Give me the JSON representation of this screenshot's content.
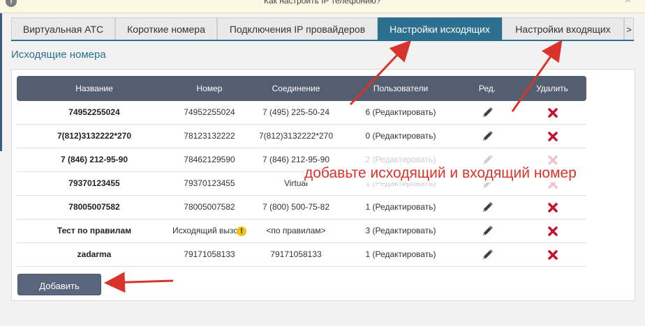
{
  "topbar": {
    "help_link": "Как настроить IP телефонию?",
    "close": "×",
    "info": "!"
  },
  "tabs": [
    {
      "label": "Виртуальная АТС",
      "active": false
    },
    {
      "label": "Короткие номера",
      "active": false
    },
    {
      "label": "Подключения IP провайдеров",
      "active": false
    },
    {
      "label": "Настройки исходящих",
      "active": true
    },
    {
      "label": "Настройки входящих",
      "active": false
    }
  ],
  "tabs_more": ">",
  "section_title": "Исходящие номера",
  "table": {
    "headers": [
      "Название",
      "Номер",
      "Соединение",
      "Пользователи",
      "Ред.",
      "Удалить"
    ],
    "rows": [
      {
        "name": "74952255024",
        "number": "74952255024",
        "connection": "7 (495) 225-50-24",
        "users": "6 (Редактировать)",
        "faded": false
      },
      {
        "name": "7(812)3132222*270",
        "number": "78123132222",
        "connection": "7(812)3132222*270",
        "users": "0 (Редактировать)",
        "faded": false
      },
      {
        "name": "7 (846) 212-95-90",
        "number": "78462129590",
        "connection": "7 (846) 212-95-90",
        "users": "2 (Редактировать)",
        "faded": true
      },
      {
        "name": "79370123455",
        "number": "79370123455",
        "connection": "Virtual",
        "users": "1 (Редактировать)",
        "faded": true
      },
      {
        "name": "78005007582",
        "number": "78005007582",
        "connection": "7 (800) 500-75-82",
        "users": "1 (Редактировать)",
        "faded": false
      },
      {
        "name": "Тест по правилам",
        "number": "Исходящий вызо",
        "connection": "<по правилам>",
        "users": "3 (Редактировать)",
        "faded": false,
        "warning": true
      },
      {
        "name": "zadarma",
        "number": "79171058133",
        "connection": "79171058133",
        "users": "1 (Редактировать)",
        "faded": false
      }
    ]
  },
  "add_button": "Добавить",
  "annotation": "добавьте исходящий и входящий номер",
  "colors": {
    "accent": "#2d6f8e",
    "header": "#545e71",
    "delete": "#c8102e",
    "annotation": "#d9342b"
  }
}
